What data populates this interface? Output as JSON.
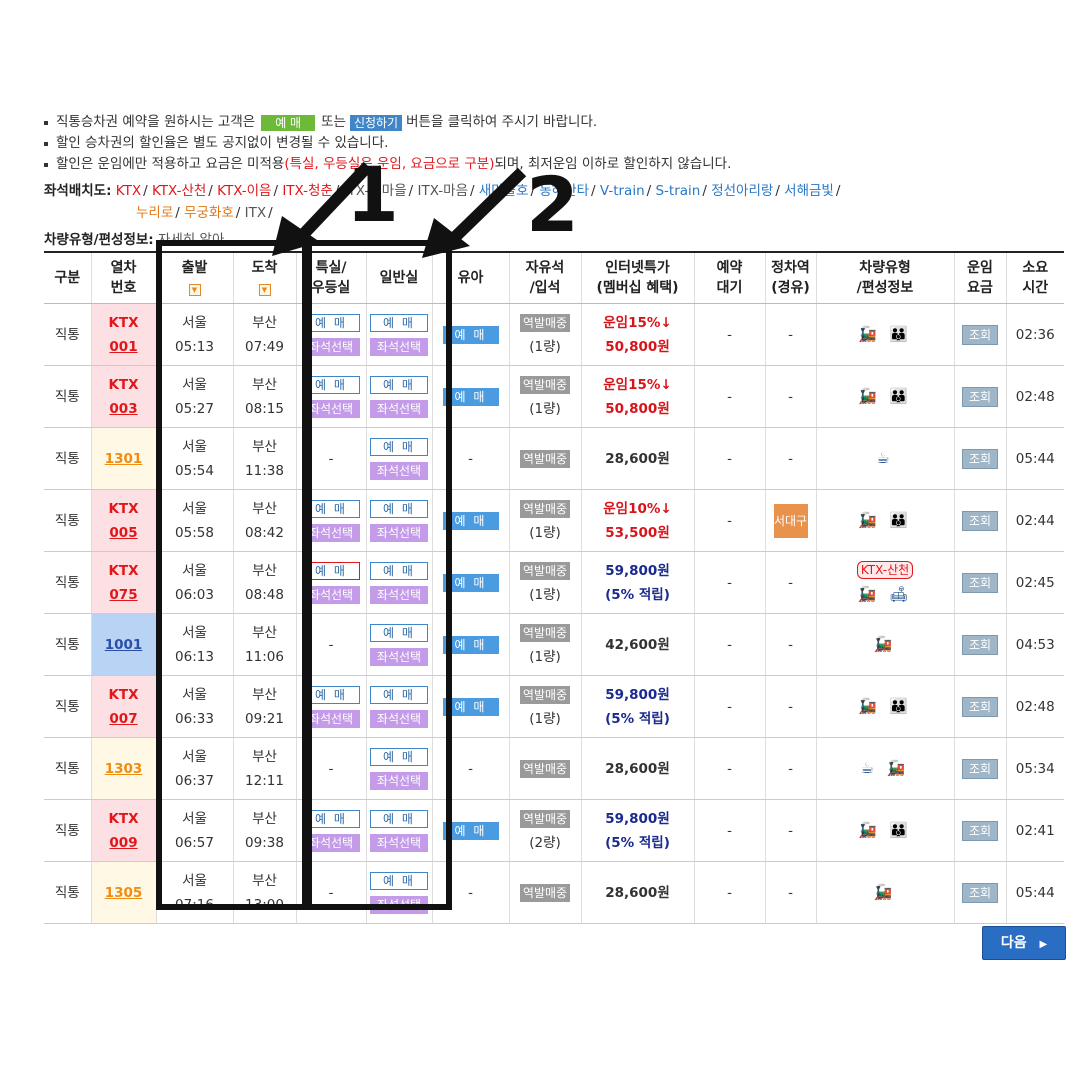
{
  "notes": {
    "line1": {
      "prefix": "직통승차권 예약을 원하시는 고객은",
      "chip1": "예 매",
      "mid": "또는",
      "chip2": "신청하기",
      "suffix": "버튼을 클릭하여 주시기 바랍니다."
    },
    "line2": "할인 승차권의 할인율은 별도 공지없이 변경될 수 있습니다.",
    "line3": {
      "prefix": "할인은 운임에만 적용하고 요금은 미적용",
      "red": "(특실, 우등실은 운임, 요금으로 구분)",
      "suffix": "되며, 최저운임 이하로 할인하지 않습니다."
    }
  },
  "seatmap": {
    "label": "좌석배치도:",
    "links": [
      {
        "text": "KTX",
        "color": "#e0181b"
      },
      {
        "text": "KTX-산천",
        "color": "#e0181b"
      },
      {
        "text": "KTX-이음",
        "color": "#e0181b"
      },
      {
        "text": "ITX-청춘",
        "color": "#e0181b"
      },
      {
        "text": "ITX-새마을",
        "color": "#555555"
      },
      {
        "text": "ITX-마음",
        "color": "#555555"
      },
      {
        "text": "새마을호",
        "color": "#2878c8"
      },
      {
        "text": "동해산타",
        "color": "#2878c8"
      },
      {
        "text": "V-train",
        "color": "#2878c8"
      },
      {
        "text": "S-train",
        "color": "#2878c8"
      },
      {
        "text": "정선아리랑",
        "color": "#2878c8"
      },
      {
        "text": "서해금빛",
        "color": "#2878c8"
      }
    ],
    "links2": [
      {
        "text": "누리로",
        "color": "#e07818"
      },
      {
        "text": "무궁화호",
        "color": "#e07818"
      },
      {
        "text": "ITX",
        "color": "#555555"
      }
    ]
  },
  "vehicle": {
    "label": "차량유형/편성정보:",
    "sub": "자세히 알아"
  },
  "table": {
    "headers": {
      "type": "구분",
      "train_no": "열차\n번호",
      "dep": "출발",
      "arr": "도착",
      "first": "특실/\n우등실",
      "normal": "일반실",
      "baby": "유아",
      "free": "자유석\n/입석",
      "internet": "인터넷특가\n(멤버십 혜택)",
      "wait": "예약\n대기",
      "stop": "정차역\n(경유)",
      "car": "차량유형\n/편성정보",
      "fare": "운임\n요금",
      "time": "소요\n시간"
    },
    "labels": {
      "reserve": "예 매",
      "seat_select": "좌석선택",
      "standing": "역발매중",
      "lookup": "조회",
      "dash": "-"
    },
    "rows": [
      {
        "type": "직통",
        "brand": "KTX",
        "no": "001",
        "cls": "ktx",
        "from": "서울",
        "dep": "05:13",
        "to": "부산",
        "arr": "07:49",
        "first": true,
        "first_red": false,
        "baby": true,
        "cars": "(1량)",
        "fare1": "운임15%↓",
        "fare2": "50,800원",
        "fare_style": "red",
        "stop": "",
        "car_icons": "🚂 👪",
        "car_tag": "",
        "dur": "02:36"
      },
      {
        "type": "직통",
        "brand": "KTX",
        "no": "003",
        "cls": "ktx",
        "from": "서울",
        "dep": "05:27",
        "to": "부산",
        "arr": "08:15",
        "first": true,
        "first_red": false,
        "baby": true,
        "cars": "(1량)",
        "fare1": "운임15%↓",
        "fare2": "50,800원",
        "fare_style": "red",
        "stop": "",
        "car_icons": "🚂 👪",
        "car_tag": "",
        "dur": "02:48"
      },
      {
        "type": "직통",
        "brand": "",
        "no": "1301",
        "cls": "muk",
        "from": "서울",
        "dep": "05:54",
        "to": "부산",
        "arr": "11:38",
        "first": false,
        "first_red": false,
        "baby": false,
        "cars": "",
        "fare1": "",
        "fare2": "28,600원",
        "fare_style": "black",
        "stop": "",
        "car_icons": "☕",
        "car_tag": "",
        "dur": "05:44"
      },
      {
        "type": "직통",
        "brand": "KTX",
        "no": "005",
        "cls": "ktx",
        "from": "서울",
        "dep": "05:58",
        "to": "부산",
        "arr": "08:42",
        "first": true,
        "first_red": false,
        "baby": true,
        "cars": "(1량)",
        "fare1": "운임10%↓",
        "fare2": "53,500원",
        "fare_style": "red",
        "stop": "서대구",
        "car_icons": "🚂 👪",
        "car_tag": "",
        "dur": "02:44"
      },
      {
        "type": "직통",
        "brand": "KTX",
        "no": "075",
        "cls": "ktx",
        "from": "서울",
        "dep": "06:03",
        "to": "부산",
        "arr": "08:48",
        "first": true,
        "first_red": true,
        "baby": true,
        "cars": "(1량)",
        "fare1": "59,800원",
        "fare2": "(5% 적립)",
        "fare_style": "navy",
        "stop": "",
        "car_icons": "🚂 🛋",
        "car_tag": "KTX-산천",
        "dur": "02:45"
      },
      {
        "type": "직통",
        "brand": "",
        "no": "1001",
        "cls": "itx",
        "from": "서울",
        "dep": "06:13",
        "to": "부산",
        "arr": "11:06",
        "first": false,
        "first_red": false,
        "baby": true,
        "cars": "(1량)",
        "fare1": "",
        "fare2": "42,600원",
        "fare_style": "black",
        "stop": "",
        "car_icons": "🚂",
        "car_tag": "",
        "dur": "04:53"
      },
      {
        "type": "직통",
        "brand": "KTX",
        "no": "007",
        "cls": "ktx",
        "from": "서울",
        "dep": "06:33",
        "to": "부산",
        "arr": "09:21",
        "first": true,
        "first_red": false,
        "baby": true,
        "cars": "(1량)",
        "fare1": "59,800원",
        "fare2": "(5% 적립)",
        "fare_style": "navy",
        "stop": "",
        "car_icons": "🚂 👪",
        "car_tag": "",
        "dur": "02:48"
      },
      {
        "type": "직통",
        "brand": "",
        "no": "1303",
        "cls": "muk",
        "from": "서울",
        "dep": "06:37",
        "to": "부산",
        "arr": "12:11",
        "first": false,
        "first_red": false,
        "baby": false,
        "cars": "",
        "fare1": "",
        "fare2": "28,600원",
        "fare_style": "black",
        "stop": "",
        "car_icons": "☕ 🚂",
        "car_tag": "",
        "dur": "05:34"
      },
      {
        "type": "직통",
        "brand": "KTX",
        "no": "009",
        "cls": "ktx",
        "from": "서울",
        "dep": "06:57",
        "to": "부산",
        "arr": "09:38",
        "first": true,
        "first_red": false,
        "baby": true,
        "cars": "(2량)",
        "fare1": "59,800원",
        "fare2": "(5% 적립)",
        "fare_style": "navy",
        "stop": "",
        "car_icons": "🚂 👪",
        "car_tag": "",
        "dur": "02:41"
      },
      {
        "type": "직통",
        "brand": "",
        "no": "1305",
        "cls": "muk",
        "from": "서울",
        "dep": "07:16",
        "to": "부산",
        "arr": "13:00",
        "first": false,
        "first_red": false,
        "baby": false,
        "cars": "",
        "fare1": "",
        "fare2": "28,600원",
        "fare_style": "black",
        "stop": "",
        "car_icons": "🚂",
        "car_tag": "",
        "dur": "05:44"
      }
    ]
  },
  "next_button": {
    "label": "다음",
    "icon": "chevron-right-icon"
  },
  "annotations": {
    "box1_label": "1",
    "box2_label": "2"
  }
}
